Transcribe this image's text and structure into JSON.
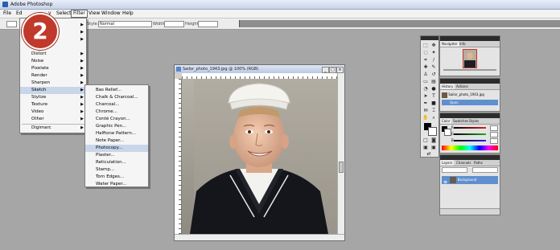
{
  "window": {
    "title": "Adobe Photoshop"
  },
  "step_badge": {
    "number": "2",
    "color": "#c0392b"
  },
  "menubar": {
    "items": [
      {
        "label": "File"
      },
      {
        "label": "Ed"
      },
      {
        "label": "y"
      },
      {
        "label": "Select"
      },
      {
        "label": "Filter",
        "active": true
      },
      {
        "label": "View"
      },
      {
        "label": "Window"
      },
      {
        "label": "Help"
      }
    ]
  },
  "options_bar": {
    "style_label": "Style:",
    "style_value": "Normal",
    "width_label": "Width:",
    "height_label": "Height:"
  },
  "filter_menu": {
    "items": [
      {
        "label": "",
        "submenu": true
      },
      {
        "label": "",
        "submenu": true
      },
      {
        "label": "",
        "submenu": true
      },
      {
        "label": "Distort",
        "submenu": true
      },
      {
        "label": "Noise",
        "submenu": true
      },
      {
        "label": "Pixelate",
        "submenu": true
      },
      {
        "label": "Render",
        "submenu": true
      },
      {
        "label": "Sharpen",
        "submenu": true
      },
      {
        "label": "Sketch",
        "submenu": true,
        "active": true
      },
      {
        "label": "Stylize",
        "submenu": true
      },
      {
        "label": "Texture",
        "submenu": true
      },
      {
        "label": "Video",
        "submenu": true
      },
      {
        "label": "Other",
        "submenu": true
      },
      {
        "label": "Digimarc",
        "submenu": true
      }
    ]
  },
  "sketch_menu": {
    "items": [
      {
        "label": "Bas Relief..."
      },
      {
        "label": "Chalk & Charcoal..."
      },
      {
        "label": "Charcoal..."
      },
      {
        "label": "Chrome..."
      },
      {
        "label": "Conté Crayon..."
      },
      {
        "label": "Graphic Pen..."
      },
      {
        "label": "Halftone Pattern..."
      },
      {
        "label": "Note Paper..."
      },
      {
        "label": "Photocopy...",
        "hover": true
      },
      {
        "label": "Plaster..."
      },
      {
        "label": "Reticulation..."
      },
      {
        "label": "Stamp..."
      },
      {
        "label": "Torn Edges..."
      },
      {
        "label": "Water Paper..."
      }
    ]
  },
  "document": {
    "title": "Sailor_photo_1943.jpg @ 100% (RGB)"
  },
  "panels": {
    "navigator": {
      "tabs": [
        "Navigator",
        "Info"
      ]
    },
    "history": {
      "tabs": [
        "History",
        "Actions"
      ],
      "rows": [
        "Sailor_photo_1943.jpg",
        "Open"
      ]
    },
    "color": {
      "tabs": [
        "Color",
        "Swatches",
        "Styles"
      ],
      "channels": [
        "R",
        "G",
        "B"
      ],
      "values": [
        "",
        "",
        ""
      ]
    },
    "layers": {
      "tabs": [
        "Layers",
        "Channels",
        "Paths"
      ],
      "layer_name": "Background"
    }
  },
  "colors": {
    "accent": "#c0392b",
    "selection": "#5f8fcf",
    "workspace": "#a6a6a6"
  }
}
